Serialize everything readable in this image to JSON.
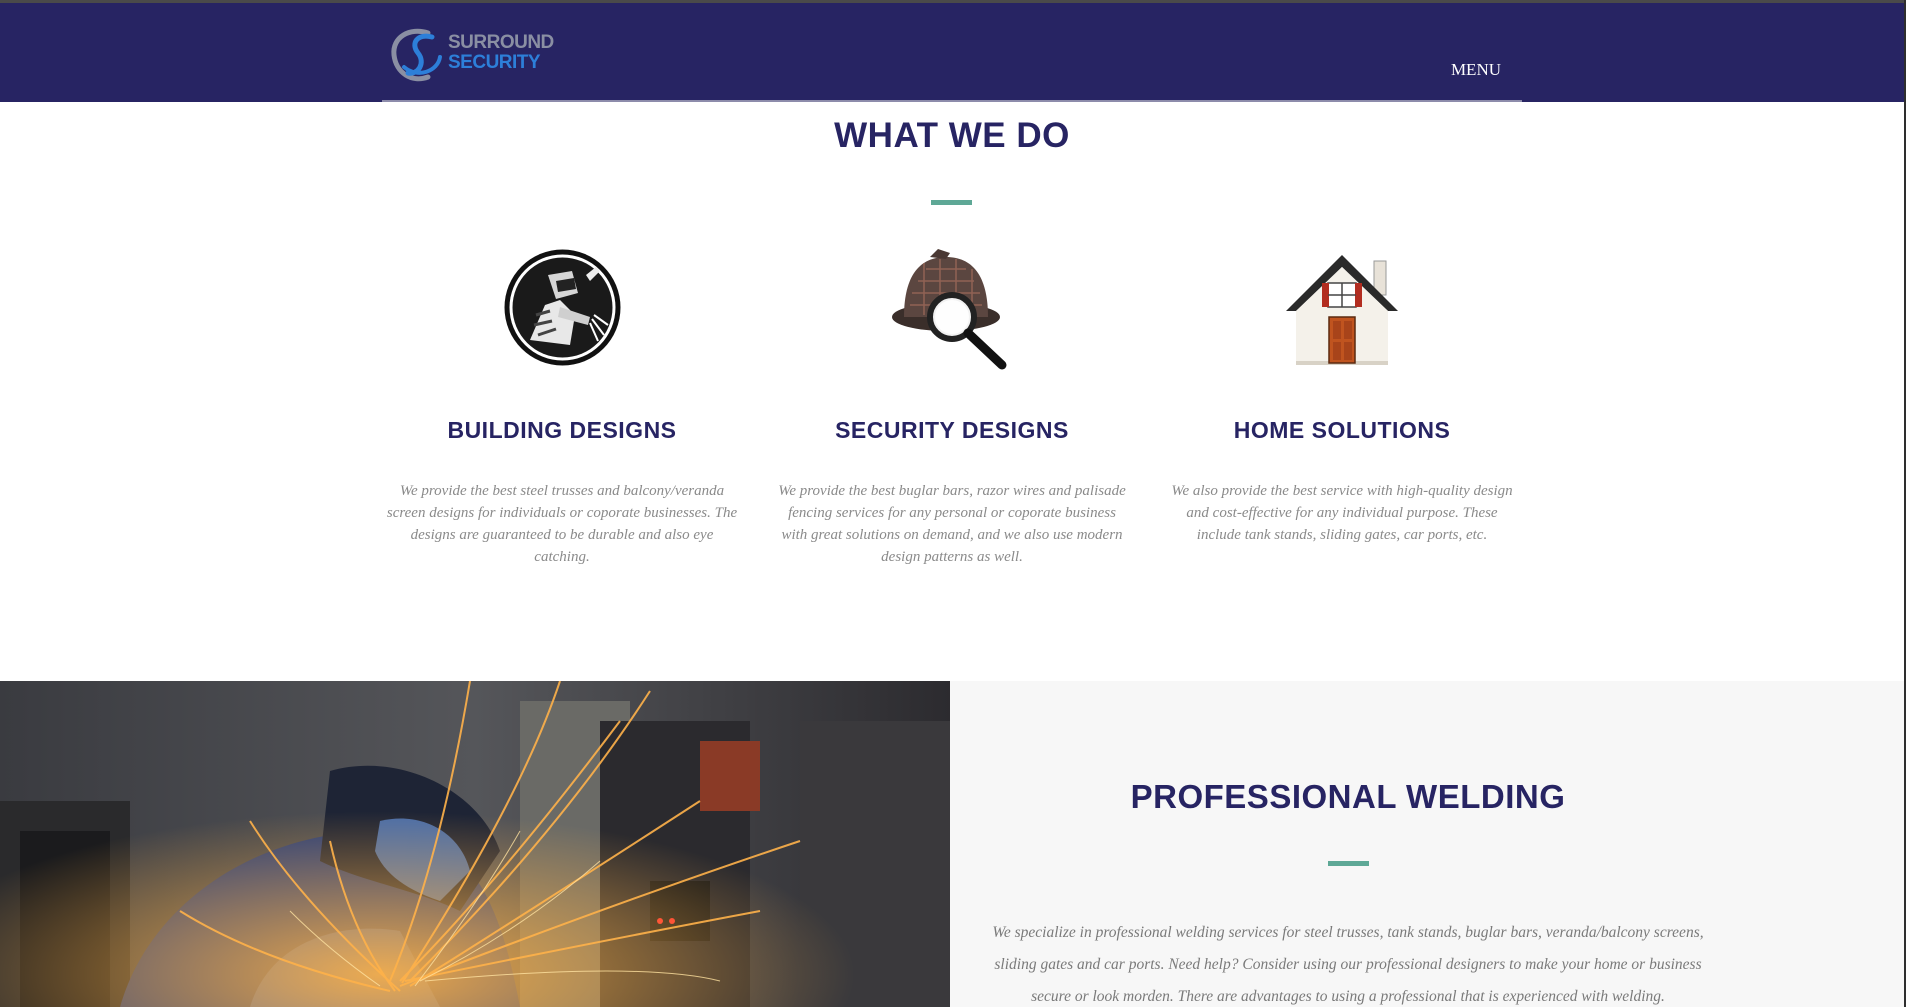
{
  "header": {
    "logo_line1": "SURROUND",
    "logo_line2": "SECURITY",
    "menu_label": "MENU"
  },
  "what_we_do": {
    "title": "WHAT WE DO",
    "columns": [
      {
        "icon": "welder-icon",
        "title": "BUILDING DESIGNS",
        "text": "We provide the best steel trusses and balcony/veranda screen designs for individuals or coporate businesses. The designs are guaranteed to be durable and also eye catching."
      },
      {
        "icon": "detective-magnifier-icon",
        "title": "SECURITY DESIGNS",
        "text": "We provide the best buglar bars, razor wires and palisade fencing services for any personal or coporate business with great solutions on demand, and we also use modern design patterns as well."
      },
      {
        "icon": "house-icon",
        "title": "HOME SOLUTIONS",
        "text": "We also provide the best service with high-quality design and cost-effective for any individual purpose. These include tank stands, sliding gates, car ports, etc."
      }
    ]
  },
  "welding": {
    "title": "PROFESSIONAL WELDING",
    "text": "We specialize in professional welding services for steel trusses, tank stands, buglar bars, veranda/balcony screens, sliding gates and car ports. Need help? Consider using our professional designers to make your home or business secure or look morden. There are advantages to using a professional that is experienced with welding."
  },
  "colors": {
    "navy": "#272463",
    "accent": "#5ea896",
    "body_text": "#8a8a8a"
  }
}
